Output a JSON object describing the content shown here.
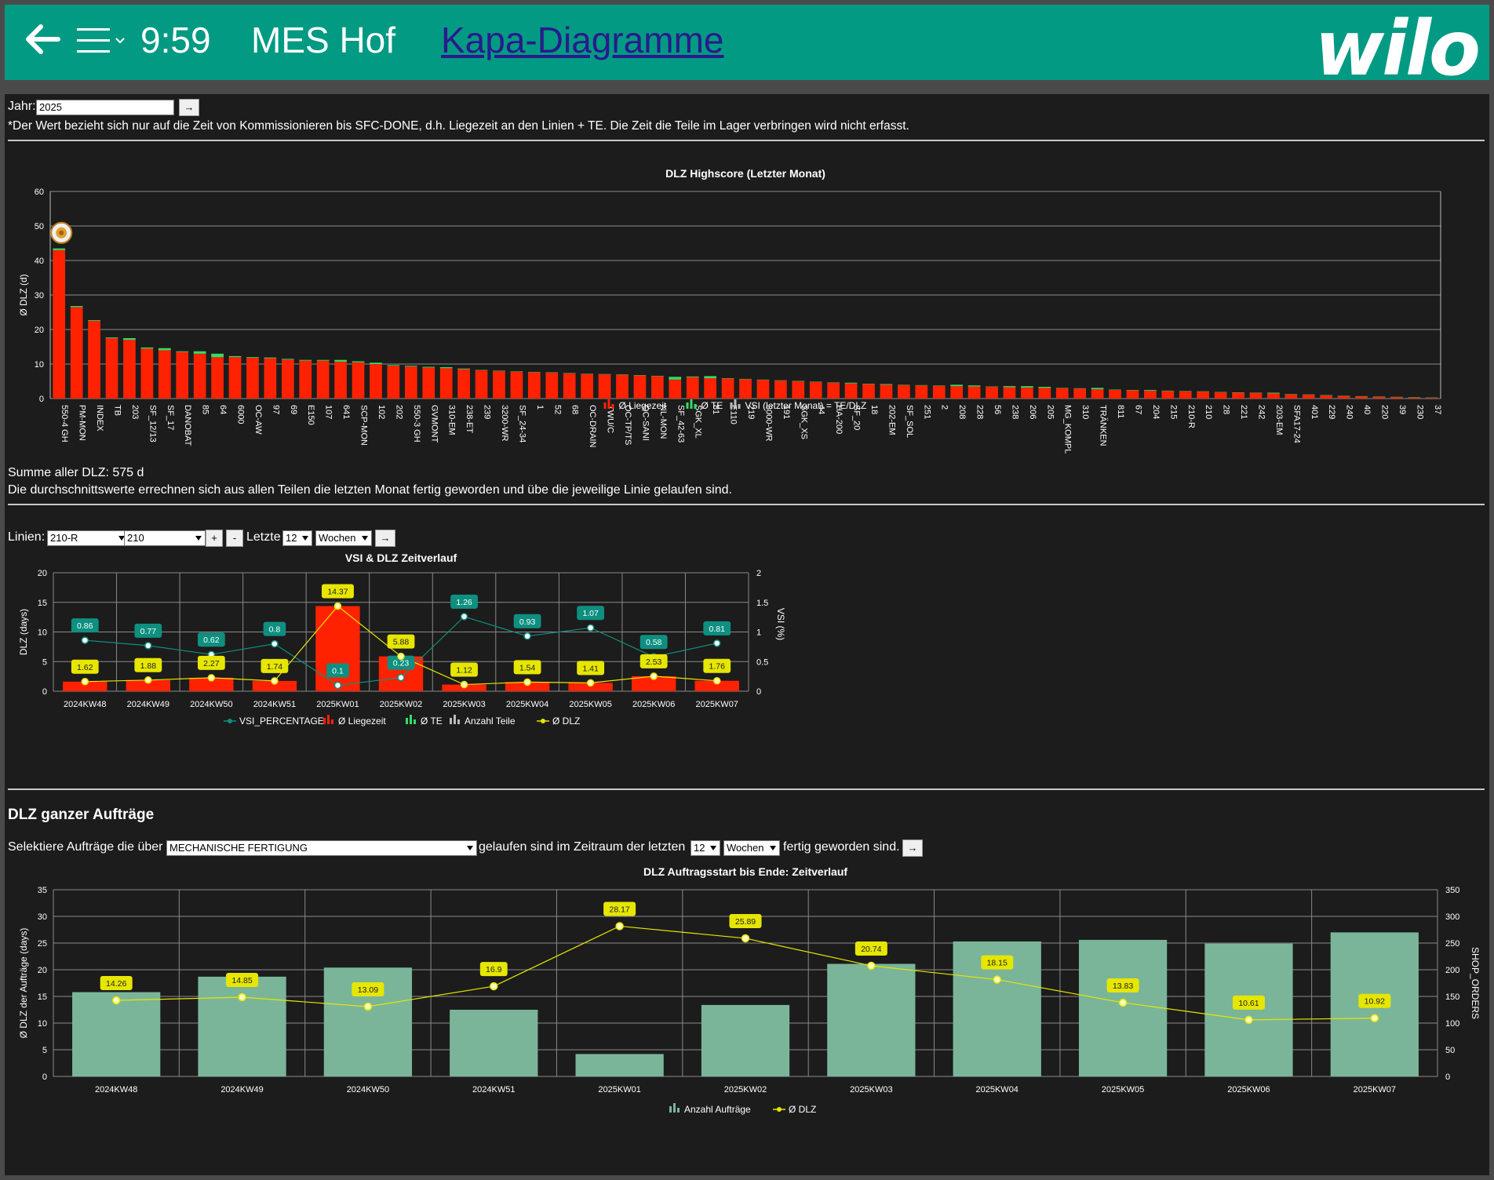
{
  "header": {
    "time": "9:59",
    "app_name": "MES Hof",
    "nav_link": "Kapa-Diagramme",
    "brand": "wilo"
  },
  "colors": {
    "header": "#029a83",
    "liegezeit": "#ff2200",
    "te": "#33dd66",
    "vsi": "#0e8f80",
    "dlz": "#e6e600",
    "anzahl": "#7ab59a"
  },
  "year_form": {
    "label": "Jahr:",
    "value": "2025",
    "go": "→"
  },
  "note": "*Der Wert bezieht sich nur auf die Zeit von Kommissionieren bis SFC-DONE, d.h. Liegezeit an den Linien + TE. Die Zeit die Teile im Lager verbringen wird nicht erfasst.",
  "summary": {
    "total": "Summe aller DLZ: 575 d",
    "explain": "Die durchschnittswerte errechnen sich aus allen Teilen die letzten Monat fertig geworden und übe die jeweilige Linie gelaufen sind."
  },
  "line_form": {
    "label": "Linien:",
    "line1": "210-R",
    "line2": "210",
    "plus": "+",
    "minus": "-",
    "letzte": "Letzte",
    "count": "12",
    "unit": "Wochen",
    "go": "→"
  },
  "orders_section": {
    "heading": "DLZ ganzer Aufträge",
    "select_prefix": "Selektiere Aufträge die über",
    "department": "MECHANISCHE FERTIGUNG",
    "middle": "gelaufen sind im Zeitraum der letzten",
    "count": "12",
    "unit": "Wochen",
    "suffix": "fertig geworden sind.",
    "go": "→"
  },
  "chart_data": [
    {
      "type": "bar",
      "title": "DLZ Highscore (Letzter Monat)",
      "ylabel": "Ø DLZ (d)",
      "ylim": [
        0,
        60
      ],
      "yticks": [
        0,
        10,
        20,
        30,
        40,
        50,
        60
      ],
      "legend": [
        "Ø Liegezeit",
        "Ø TE",
        "VSI (letzter Monat) = TE/DLZ"
      ],
      "legend_position": "bottom",
      "grid": true,
      "categories": [
        "550-4 GH",
        "PM-MON",
        "INDEX",
        "TB",
        "203",
        "SF_12/13",
        "SF_17",
        "DANOBAT",
        "85",
        "64",
        "6000",
        "OC-AW",
        "97",
        "69",
        "E150",
        "107",
        "641",
        "SCP-MON",
        "102",
        "202",
        "550-3 GH",
        "GVMONT",
        "310-EM",
        "238-ET",
        "239",
        "3200-WR",
        "SF_24-34",
        "1",
        "52",
        "68",
        "OC-DRAIN",
        "TWU/C",
        "OC-TP/TS",
        "OC-SANI",
        "NL-MON",
        "SF_42-63",
        "SGK_XL",
        "81",
        "E110",
        "219",
        "3000-WR",
        "191",
        "SGK_XS",
        "44",
        "HA-200",
        "SF_20",
        "18",
        "202-EM",
        "SF_SOL",
        "251",
        "2",
        "208",
        "228",
        "56",
        "238",
        "206",
        "205",
        "MG_KOMPL",
        "310",
        "TRÄNKEN",
        "811",
        "67",
        "204",
        "215",
        "210-R",
        "210",
        "28",
        "221",
        "242",
        "203-EM",
        "SFA17-24",
        "401",
        "229",
        "240",
        "40",
        "220",
        "39",
        "230",
        "37"
      ],
      "series": [
        {
          "name": "Ø Liegezeit",
          "values": [
            43,
            26.5,
            22.5,
            17.5,
            17,
            14.5,
            14,
            13.5,
            13,
            12,
            12,
            11.8,
            11.7,
            11.3,
            11,
            11,
            10.7,
            10.5,
            10,
            9.5,
            9.3,
            9,
            8.8,
            8.5,
            8.2,
            8,
            7.8,
            7.6,
            7.5,
            7.3,
            7.1,
            7,
            6.9,
            6.7,
            6.5,
            5.5,
            6.2,
            5.9,
            5.8,
            5.6,
            5.4,
            5.2,
            5,
            4.8,
            4.6,
            4.4,
            4.2,
            4,
            3.9,
            3.8,
            3.7,
            3.6,
            3.5,
            3.4,
            3.3,
            3.2,
            3.1,
            3,
            2.9,
            2.7,
            2.5,
            2.4,
            2.3,
            2.2,
            2.1,
            2,
            1.8,
            1.7,
            1.6,
            1.5,
            1.2,
            1.1,
            0.9,
            0.7,
            0.6,
            0.5,
            0.4,
            0.3,
            0.2
          ]
        },
        {
          "name": "Ø TE",
          "values": [
            0.5,
            0.3,
            0.2,
            0.2,
            0.5,
            0.3,
            0.6,
            0.2,
            0.7,
            1,
            0.3,
            0.2,
            0.2,
            0.2,
            0.2,
            0.2,
            0.5,
            0.3,
            0.4,
            0.2,
            0.2,
            0.2,
            0.3,
            0.2,
            0.1,
            0.1,
            0.1,
            0.1,
            0.1,
            0.1,
            0.1,
            0.1,
            0.1,
            0.1,
            0.1,
            0.8,
            0.2,
            0.6,
            0.1,
            0.1,
            0.1,
            0.1,
            0.1,
            0.1,
            0.1,
            0.2,
            0.1,
            0.2,
            0.1,
            0.1,
            0.1,
            0.4,
            0.3,
            0.1,
            0.3,
            0.4,
            0.3,
            0.1,
            0.1,
            0.4,
            0.1,
            0.1,
            0.2,
            0.1,
            0.1,
            0.1,
            0.1,
            0.1,
            0.1,
            0.2,
            0.1,
            0.1,
            0.1,
            0.1,
            0.1,
            0.1,
            0.1,
            0.1,
            0.1
          ]
        }
      ]
    },
    {
      "type": "bar",
      "title": "VSI & DLZ Zeitverlauf",
      "ylabel": "DLZ (days)",
      "y2label": "VSI (%)",
      "ylim": [
        0,
        20
      ],
      "yticks": [
        0,
        5,
        10,
        15,
        20
      ],
      "y2lim": [
        0,
        2
      ],
      "y2ticks": [
        "0",
        "0.5",
        "1",
        "1.5",
        "2"
      ],
      "legend": [
        "VSI_PERCENTAGE",
        "Ø Liegezeit",
        "Ø TE",
        "Anzahl Teile",
        "Ø DLZ"
      ],
      "legend_position": "bottom",
      "grid": true,
      "categories": [
        "2024KW48",
        "2024KW49",
        "2024KW50",
        "2024KW51",
        "2025KW01",
        "2025KW02",
        "2025KW03",
        "2025KW04",
        "2025KW05",
        "2025KW06",
        "2025KW07"
      ],
      "series": [
        {
          "name": "Ø Liegezeit",
          "values": [
            1.62,
            1.88,
            2.27,
            1.74,
            14.37,
            5.88,
            1.12,
            1.54,
            1.41,
            2.53,
            1.76
          ]
        },
        {
          "name": "Ø DLZ",
          "values": [
            1.62,
            1.88,
            2.27,
            1.74,
            14.37,
            5.88,
            1.12,
            1.54,
            1.41,
            2.53,
            1.76
          ]
        },
        {
          "name": "VSI_PERCENTAGE",
          "values": [
            0.86,
            0.77,
            0.62,
            0.8,
            0.1,
            0.23,
            1.26,
            0.93,
            1.07,
            0.58,
            0.81
          ]
        }
      ],
      "dlz_labels": [
        "1.62",
        "1.88",
        "2.27",
        "1.74",
        "14.37",
        "5.88",
        "1.12",
        "1.54",
        "1.41",
        "2.53",
        "1.76"
      ],
      "vsi_labels": [
        "0.86",
        "0.77",
        "0.62",
        "0.8",
        "0.1",
        "0.23",
        "1.26",
        "0.93",
        "1.07",
        "0.58",
        "0.81"
      ]
    },
    {
      "type": "bar",
      "title": "DLZ Auftragsstart bis Ende: Zeitverlauf",
      "ylabel": "Ø DLZ der Aufträge (days)",
      "y2label": "SHOP_ORDERS",
      "ylim": [
        0,
        35
      ],
      "yticks": [
        0,
        5,
        10,
        15,
        20,
        25,
        30,
        35
      ],
      "y2lim": [
        0,
        350
      ],
      "y2ticks": [
        0,
        50,
        100,
        150,
        200,
        250,
        300,
        350
      ],
      "legend": [
        "Anzahl Aufträge",
        "Ø DLZ"
      ],
      "legend_position": "bottom",
      "grid": true,
      "categories": [
        "2024KW48",
        "2024KW49",
        "2024KW50",
        "2024KW51",
        "2025KW01",
        "2025KW02",
        "2025KW03",
        "2025KW04",
        "2025KW05",
        "2025KW06",
        "2025KW07"
      ],
      "series": [
        {
          "name": "Anzahl Aufträge",
          "values": [
            158,
            187,
            204,
            125,
            42,
            134,
            211,
            253,
            256,
            249,
            270
          ]
        },
        {
          "name": "Ø DLZ",
          "values": [
            14.26,
            14.85,
            13.09,
            16.9,
            28.17,
            25.89,
            20.74,
            18.15,
            13.83,
            10.61,
            10.92
          ]
        }
      ],
      "dlz_labels": [
        "14.26",
        "14.85",
        "13.09",
        "16.9",
        "28.17",
        "25.89",
        "20.74",
        "18.15",
        "13.83",
        "10.61",
        "10.92"
      ]
    }
  ]
}
